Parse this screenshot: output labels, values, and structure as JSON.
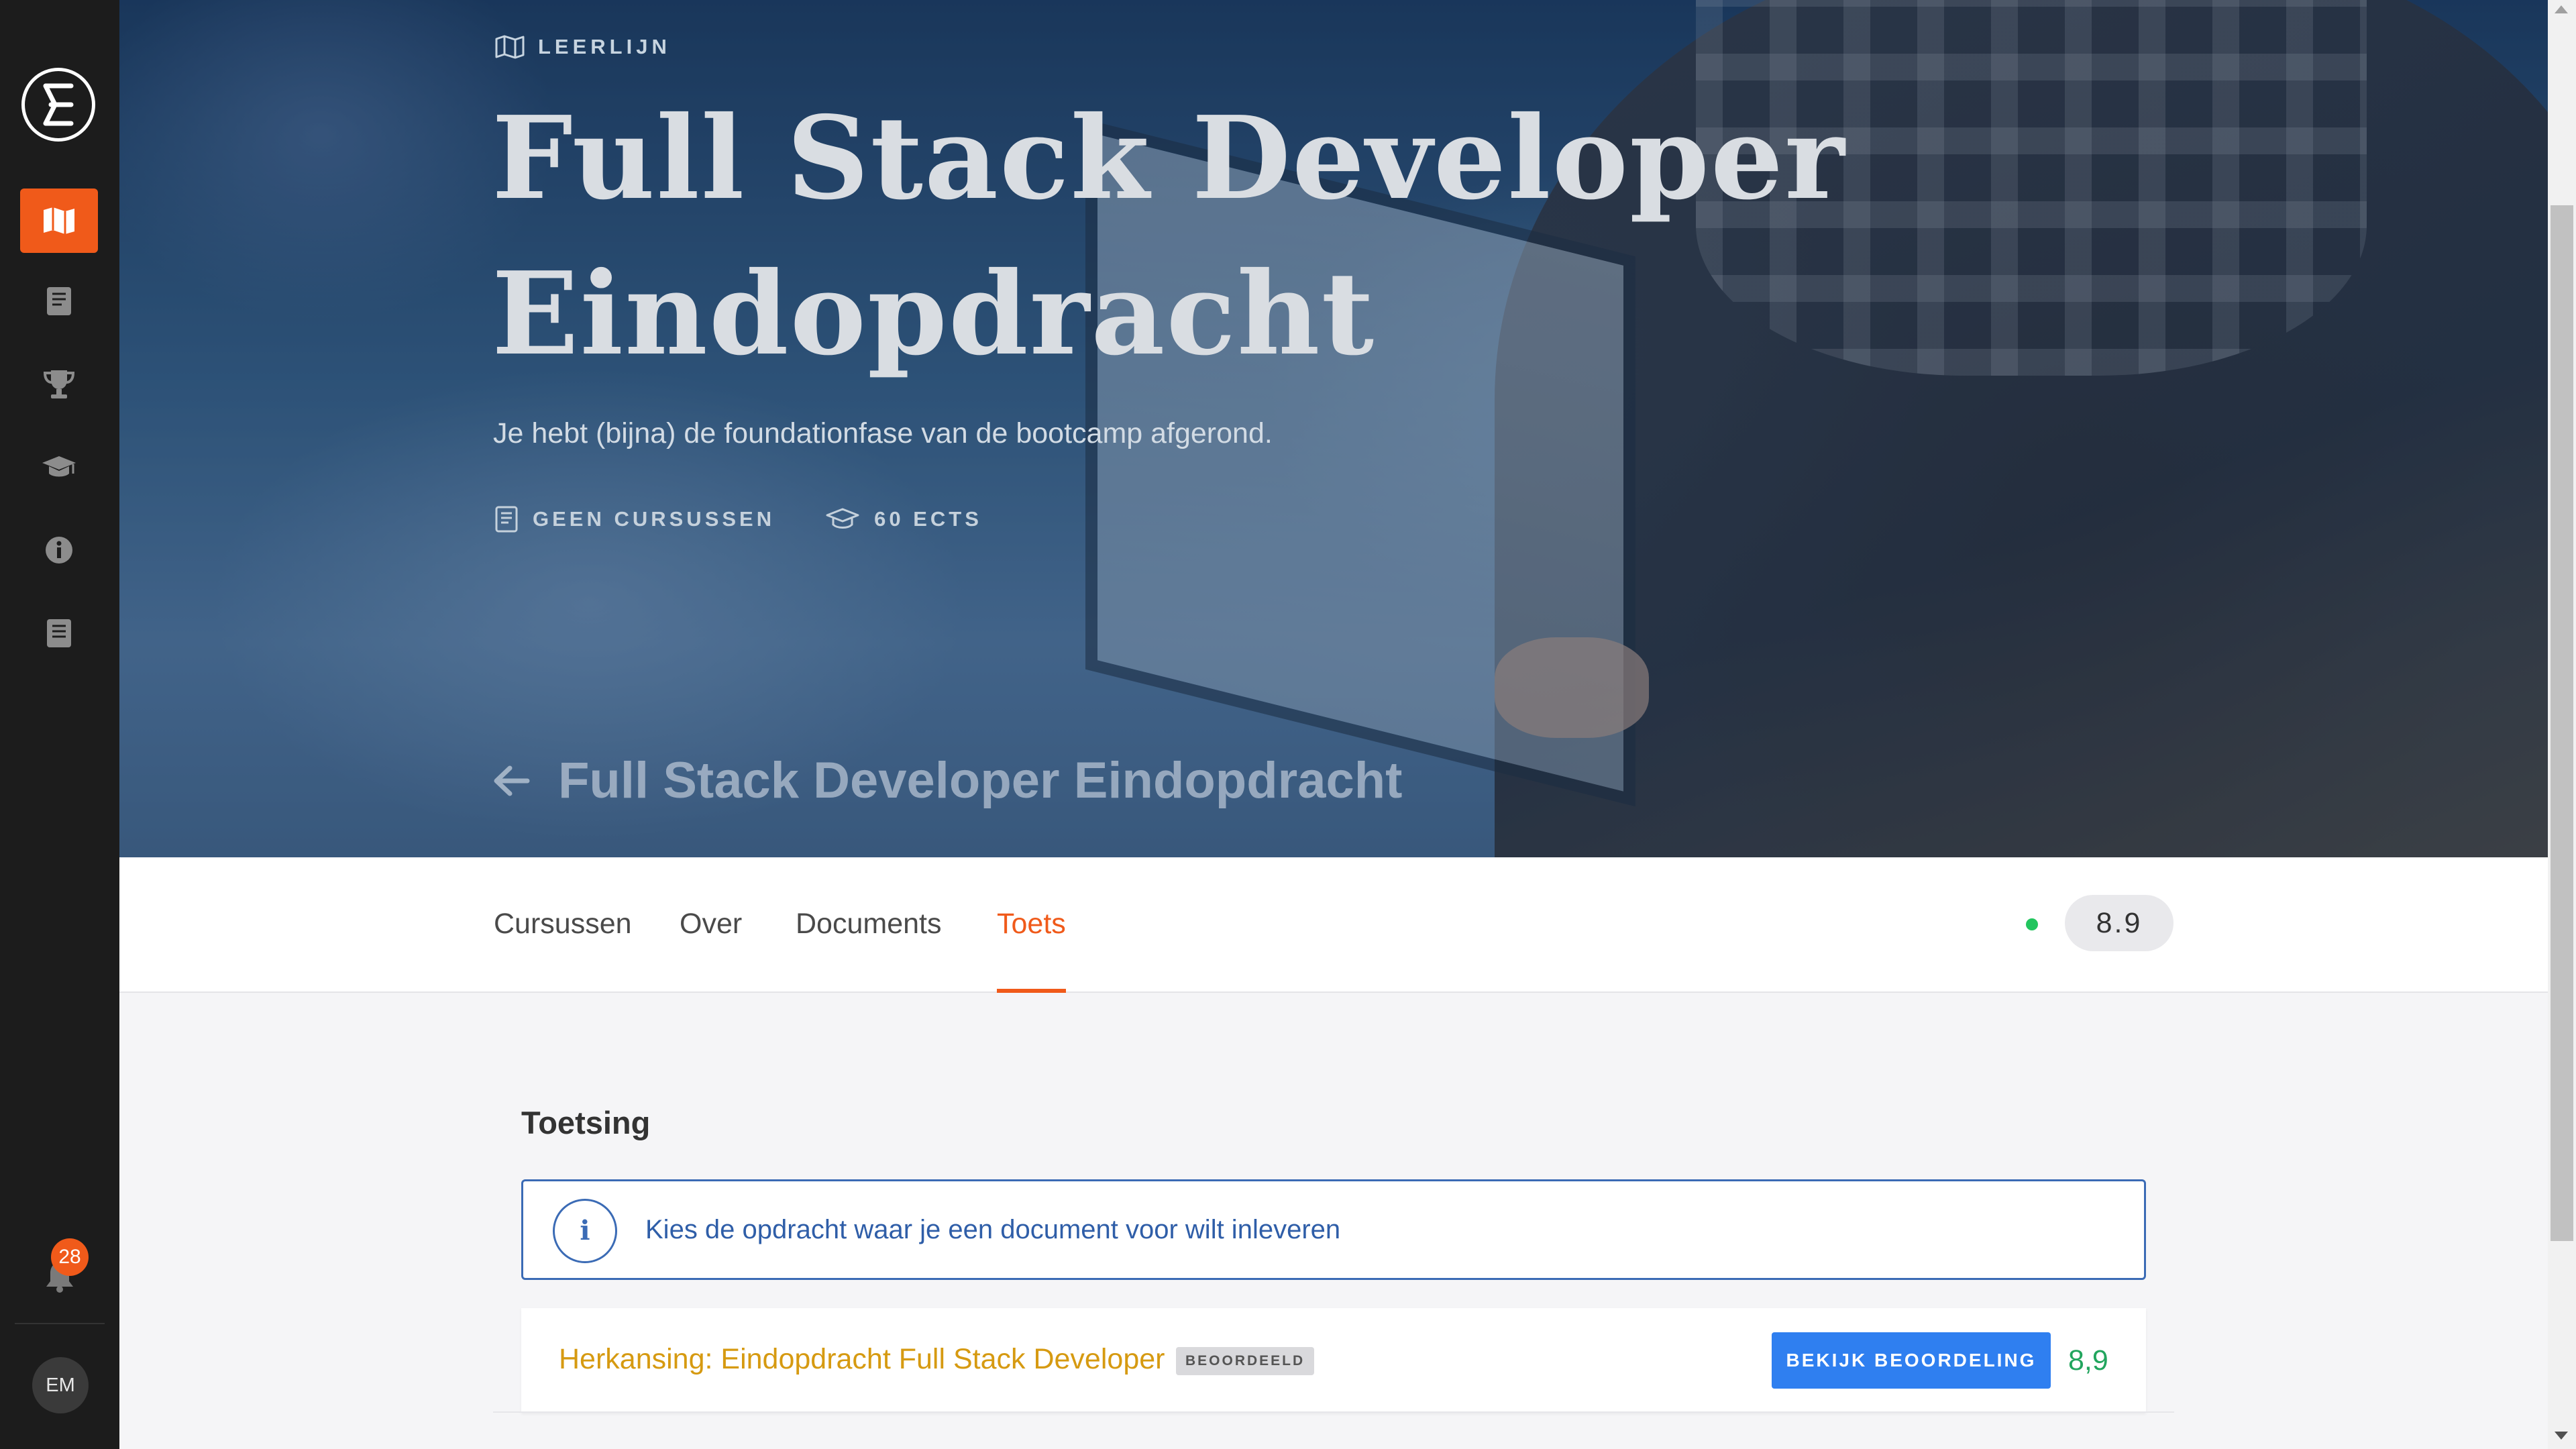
{
  "sidebar": {
    "items": [
      {
        "icon": "map-icon",
        "active": true
      },
      {
        "icon": "book-icon",
        "active": false
      },
      {
        "icon": "trophy-icon",
        "active": false
      },
      {
        "icon": "graduation-cap-icon",
        "active": false
      },
      {
        "icon": "info-icon",
        "active": false
      },
      {
        "icon": "document-icon",
        "active": false
      }
    ],
    "notifications_count": "28",
    "avatar_initials": "EM"
  },
  "hero": {
    "label": "LEERLIJN",
    "title_line1": "Full Stack Developer",
    "title_line2": "Eindopdracht",
    "description": "Je hebt (bijna) de foundationfase van de bootcamp afgerond.",
    "meta_courses": "GEEN CURSUSSEN",
    "meta_ects": "60 ECTS",
    "back_title": "Full Stack Developer Eindopdracht"
  },
  "tabs": {
    "items": [
      "Cursussen",
      "Over",
      "Documents",
      "Toets"
    ],
    "active": "Toets",
    "grade": "8.9",
    "status_color": "#22c55e"
  },
  "content": {
    "section_title": "Toetsing",
    "info_message": "Kies de opdracht waar je een document voor wilt inleveren",
    "assignment": {
      "title": "Herkansing: Eindopdracht Full Stack Developer",
      "status_badge": "BEOORDEELD",
      "button_label": "BEKIJK BEOORDELING",
      "grade": "8,9"
    }
  },
  "colors": {
    "accent": "#f05a1a",
    "info_blue": "#3b6bb5",
    "button_blue": "#2f7ff0",
    "assignment_title": "#d69a11",
    "grade_green": "#22a55e"
  }
}
